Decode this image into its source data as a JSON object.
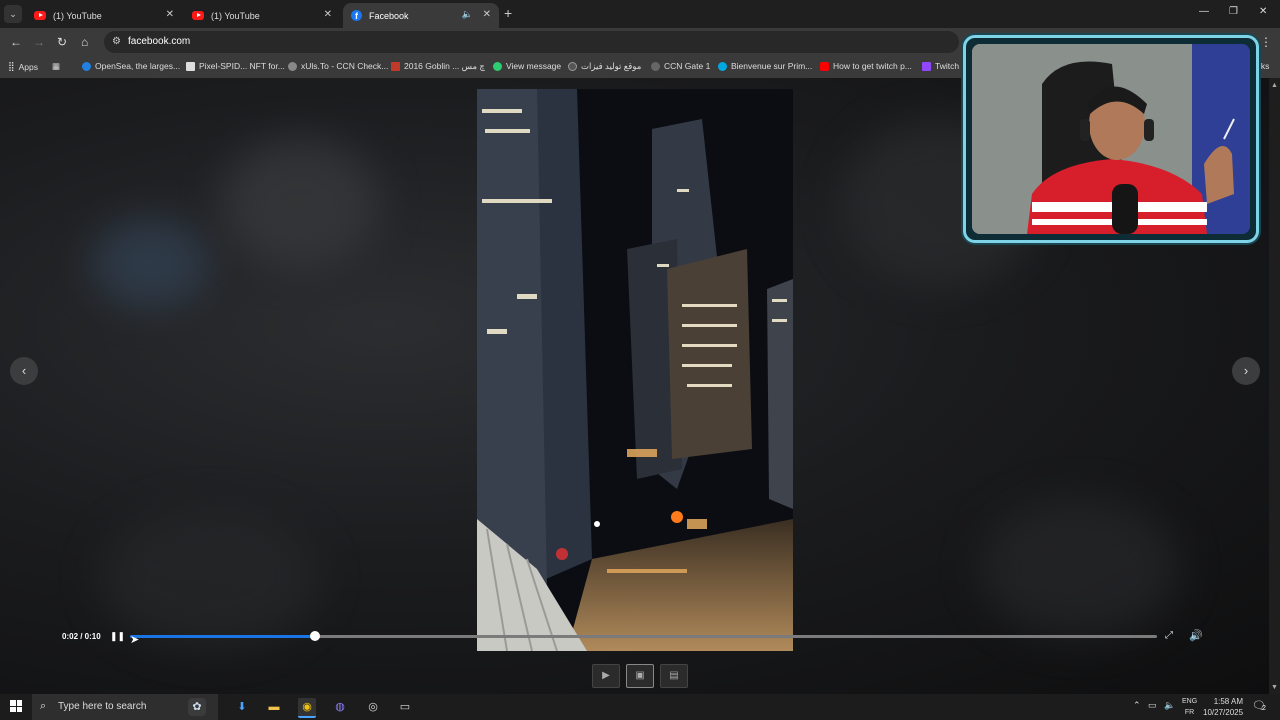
{
  "tabs": [
    {
      "title": "(1) YouTube",
      "icon": "youtube-icon",
      "active": false
    },
    {
      "title": "(1) YouTube",
      "icon": "youtube-icon",
      "active": false
    },
    {
      "title": "Facebook",
      "icon": "facebook-icon",
      "active": true
    }
  ],
  "address_bar": {
    "url": "facebook.com"
  },
  "bookmarks": [
    {
      "label": "Apps"
    },
    {
      "label": "OpenSea, the larges..."
    },
    {
      "label": "Pixel-SPID... NFT for..."
    },
    {
      "label": "xUls.To - CCN Check..."
    },
    {
      "label": "2016 Goblin ... ﭺ ﻣﺲ"
    },
    {
      "label": "View message"
    },
    {
      "label": "ﻣﻮﻗﻊ ﺗﻮﻟﻴﺪ ﻓﻴﺰات"
    },
    {
      "label": "CCN Gate 1"
    },
    {
      "label": "Bienvenue sur Prim..."
    },
    {
      "label": "How to get twitch p..."
    },
    {
      "label": "Twitch"
    },
    {
      "label": "rks"
    }
  ],
  "video": {
    "time": "0:02 / 0:10",
    "progress_fraction": 0.18,
    "state": "playing"
  },
  "taskbar": {
    "search_placeholder": "Type here to search",
    "lang_top": "ENG",
    "lang_bottom": "FR",
    "time": "1:58 AM",
    "date": "10/27/2025",
    "notification_count": "2"
  },
  "colors": {
    "progress": "#1b74e4",
    "webcam_border": "#7fd3e6",
    "accent_red": "#d71f2b"
  }
}
